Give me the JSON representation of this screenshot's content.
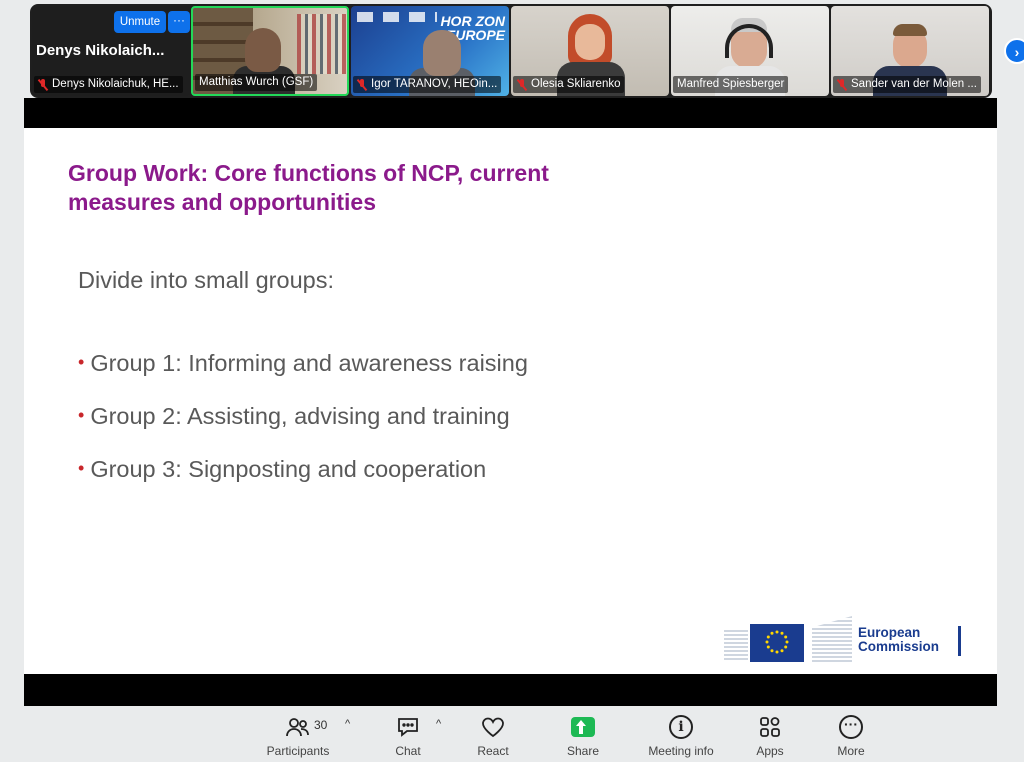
{
  "gallery": {
    "tiles": [
      {
        "big_name": "Denys  Nikolaich...",
        "label": "Denys Nikolaichuk, HE...",
        "unmute_label": "Unmute",
        "more_label": "···"
      },
      {
        "label": "Matthias Wurch (GSF)"
      },
      {
        "label": "Igor TARANOV, HEOin...",
        "bg_text": "HORIZON\nEUROPE"
      },
      {
        "label": "Olesia Skliarenko"
      },
      {
        "label": "Manfred Spiesberger"
      },
      {
        "label": "Sander van der Molen ..."
      }
    ],
    "next_arrow": "›"
  },
  "slide": {
    "title": "Group Work: Core functions of NCP, current measures and opportunities",
    "intro": "Divide into small groups:",
    "bullets": [
      "Group 1: Informing and awareness raising",
      "Group 2: Assisting, advising and training",
      "Group 3: Signposting and cooperation"
    ],
    "logo_line1": "European",
    "logo_line2": "Commission"
  },
  "toolbar": {
    "participants_label": "Participants",
    "participants_count": "30",
    "chat_label": "Chat",
    "react_label": "React",
    "share_label": "Share",
    "meeting_info_label": "Meeting info",
    "apps_label": "Apps",
    "more_label": "More",
    "caret": "^"
  },
  "colors": {
    "accent": "#0e71eb",
    "active_speaker": "#23d959",
    "slide_title": "#8b1a8b",
    "bullet": "#c8262b",
    "share_green": "#1db954"
  }
}
